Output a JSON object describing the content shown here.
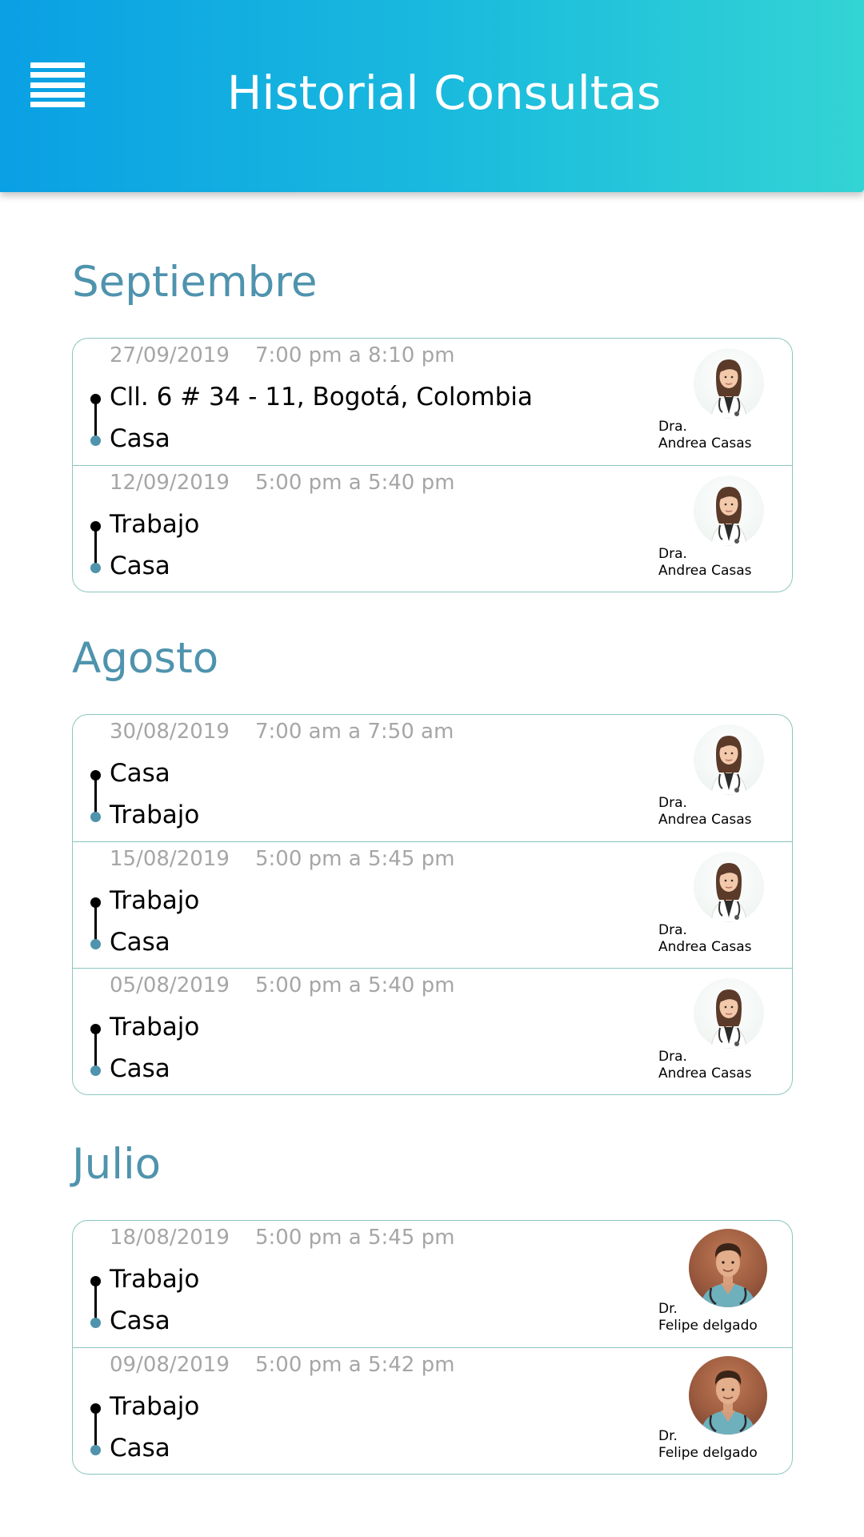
{
  "header": {
    "title": "Historial Consultas",
    "menu_icon": "hamburger-menu-icon"
  },
  "colors": {
    "header_gradient_start": "#0aa0e4",
    "header_gradient_end": "#33d4d4",
    "month_title": "#4f93ad",
    "card_border": "#8cc6be",
    "secondary_text": "#a6a6a6",
    "route_end_dot": "#4f93ad"
  },
  "months": [
    {
      "name": "Septiembre",
      "entries": [
        {
          "date": "27/09/2019",
          "time": "7:00 pm a 8:10 pm",
          "origin": "Cll. 6 # 34 - 11, Bogotá, Colombia",
          "destination": "Casa",
          "doctor_title": "Dra.",
          "doctor_name": "Andrea Casas",
          "avatar": "female-doctor-avatar"
        },
        {
          "date": "12/09/2019",
          "time": "5:00 pm a 5:40 pm",
          "origin": "Trabajo",
          "destination": "Casa",
          "doctor_title": "Dra.",
          "doctor_name": "Andrea Casas",
          "avatar": "female-doctor-avatar"
        }
      ]
    },
    {
      "name": "Agosto",
      "entries": [
        {
          "date": "30/08/2019",
          "time": "7:00 am a 7:50 am",
          "origin": "Casa",
          "destination": "Trabajo",
          "doctor_title": "Dra.",
          "doctor_name": "Andrea Casas",
          "avatar": "female-doctor-avatar"
        },
        {
          "date": "15/08/2019",
          "time": "5:00 pm a 5:45 pm",
          "origin": "Trabajo",
          "destination": "Casa",
          "doctor_title": "Dra.",
          "doctor_name": "Andrea Casas",
          "avatar": "female-doctor-avatar"
        },
        {
          "date": "05/08/2019",
          "time": "5:00 pm a 5:40 pm",
          "origin": "Trabajo",
          "destination": "Casa",
          "doctor_title": "Dra.",
          "doctor_name": "Andrea Casas",
          "avatar": "female-doctor-avatar"
        }
      ]
    },
    {
      "name": "Julio",
      "entries": [
        {
          "date": "18/08/2019",
          "time": "5:00 pm a 5:45 pm",
          "origin": "Trabajo",
          "destination": "Casa",
          "doctor_title": "Dr.",
          "doctor_name": "Felipe delgado",
          "avatar": "male-doctor-avatar"
        },
        {
          "date": "09/08/2019",
          "time": "5:00 pm a 5:42 pm",
          "origin": "Trabajo",
          "destination": "Casa",
          "doctor_title": "Dr.",
          "doctor_name": "Felipe delgado",
          "avatar": "male-doctor-avatar"
        }
      ]
    }
  ]
}
